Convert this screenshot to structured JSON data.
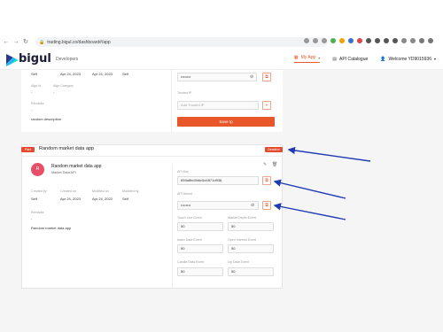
{
  "browser": {
    "url": "trading.bigul.co/dashboard#/app"
  },
  "header": {
    "logo_text": "bigul",
    "section": "Developers",
    "nav": {
      "my_app": "My App",
      "api_catalogue": "API Catalogue",
      "welcome": "Welcome YD9015936"
    }
  },
  "top_card": {
    "date1": "Apr 24, 2023",
    "date2": "Apr 24, 2023",
    "self": "Self",
    "algo_id_label": "Algo Id",
    "algo_category_label": "Algo Category",
    "dash1": "-",
    "dash2": "-",
    "remarks_label": "Remarks",
    "remarks_dash": "-",
    "remarks_text": "random description",
    "secret_masked": "••••••••",
    "trusted_ip_label": "Trusted IP",
    "trusted_ip_placeholder": "Add Trusted IP",
    "save_ip": "Save Ip"
  },
  "card": {
    "badge_paid": "Paid",
    "badge_deactivate": "Deactive",
    "title": "Random market data app",
    "avatar_letter": "R",
    "app_name": "Random market data app",
    "app_sub": "Market Data API",
    "created_by_label": "Created by",
    "created_on_label": "Created on",
    "modified_on_label": "Modified on",
    "modified_by_label": "Modified by",
    "created_by": "Self",
    "created_on": "Apr 24, 2023",
    "modified_on": "Apr 24, 2023",
    "modified_by": "Self",
    "remarks_label": "Remarks",
    "remarks_dash": "-",
    "remarks_text": "Random market data app",
    "api_key_label": "API Key",
    "api_key": "659a8bc5b6c5d4571d936",
    "api_secret_label": "API Secret",
    "api_secret": "••••••••",
    "touch_line_label": "Touch Line Event",
    "touch_line": "50",
    "market_depth_label": "Market Depth Event",
    "market_depth": "50",
    "index_data_label": "Index Data Event",
    "index_data": "50",
    "open_interest_label": "Open Interest Event",
    "open_interest": "50",
    "candle_data_label": "Candle Data Event",
    "candle_data": "50",
    "ltp_data_label": "Ltp Data Event",
    "ltp_data": "50"
  },
  "colors": {
    "accent": "#e8572a",
    "arrow": "#1f3bb3"
  },
  "icons": [
    "back-icon",
    "forward-icon",
    "reload-icon",
    "eye-off-icon",
    "copy-icon",
    "edit-icon",
    "delete-icon",
    "user-icon",
    "grid-icon"
  ]
}
